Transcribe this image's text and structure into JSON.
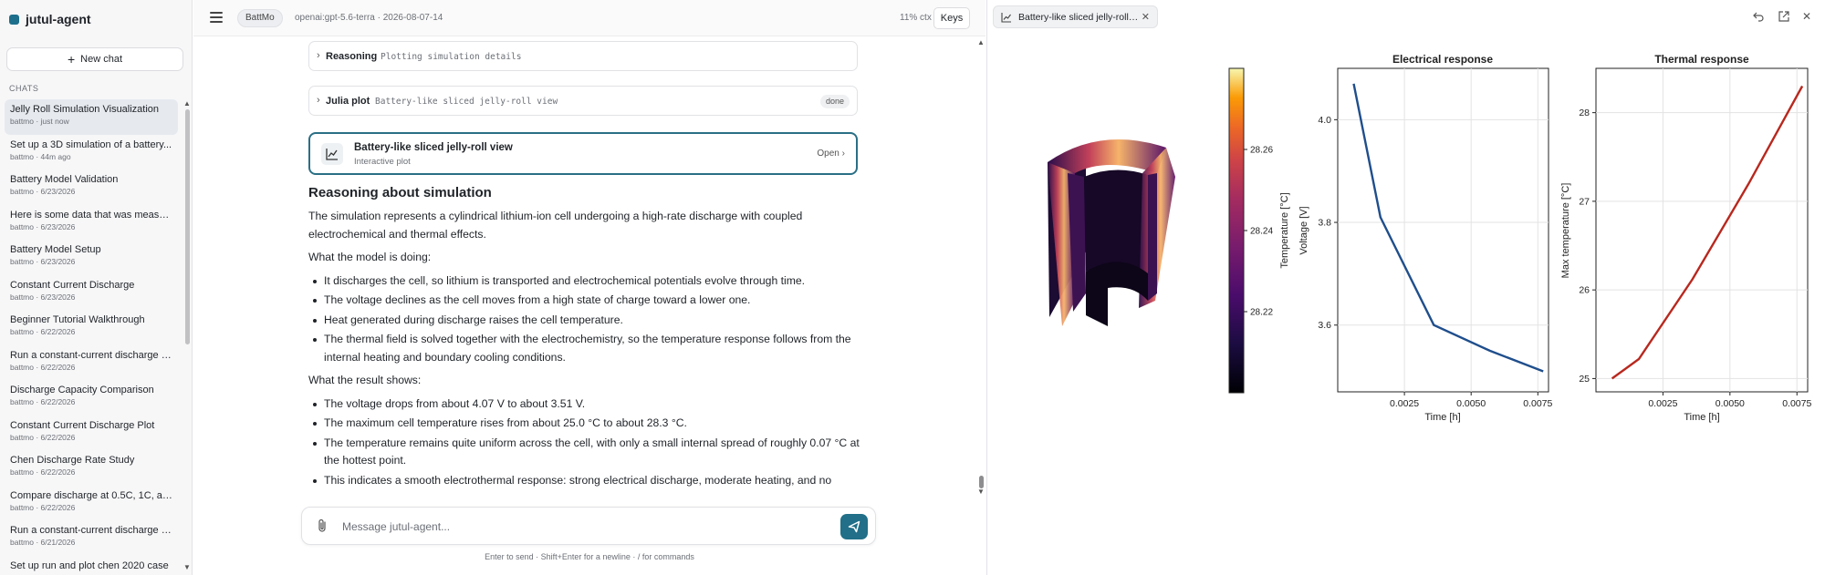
{
  "app": {
    "name": "jutul-agent"
  },
  "sidebar": {
    "new_chat_label": "New chat",
    "chats_heading": "CHATS",
    "chats": [
      {
        "title": "Jelly Roll Simulation Visualization",
        "subtitle": "battmo · just now",
        "active": true
      },
      {
        "title": "Set up a 3D simulation of a battery...",
        "subtitle": "battmo · 44m ago"
      },
      {
        "title": "Battery Model Validation",
        "subtitle": "battmo · 6/23/2026"
      },
      {
        "title": "Here is some data that was measur...",
        "subtitle": "battmo · 6/23/2026"
      },
      {
        "title": "Battery Model Setup",
        "subtitle": "battmo · 6/23/2026"
      },
      {
        "title": "Constant Current Discharge",
        "subtitle": "battmo · 6/23/2026"
      },
      {
        "title": "Beginner Tutorial Walkthrough",
        "subtitle": "battmo · 6/22/2026"
      },
      {
        "title": "Run a constant-current discharge o...",
        "subtitle": "battmo · 6/22/2026"
      },
      {
        "title": "Discharge Capacity Comparison",
        "subtitle": "battmo · 6/22/2026"
      },
      {
        "title": "Constant Current Discharge Plot",
        "subtitle": "battmo · 6/22/2026"
      },
      {
        "title": "Chen Discharge Rate Study",
        "subtitle": "battmo · 6/22/2026"
      },
      {
        "title": "Compare discharge at 0.5C, 1C, an...",
        "subtitle": "battmo · 6/22/2026"
      },
      {
        "title": "Run a constant-current discharge o...",
        "subtitle": "battmo · 6/21/2026"
      },
      {
        "title": "Set up run and plot chen 2020 case",
        "subtitle": ""
      }
    ]
  },
  "topbar": {
    "project": "BattMo",
    "model_meta": "openai:gpt-5.6-terra · 2026-08-07-14",
    "context": "11% ctx",
    "keys_label": "Keys"
  },
  "messages": {
    "reasoning": {
      "label": "Reasoning",
      "detail": "Plotting simulation details"
    },
    "julia_plot": {
      "label": "Julia plot",
      "detail": "Battery-like sliced jelly-roll view",
      "status": "done"
    },
    "plot_card": {
      "title": "Battery-like sliced jelly-roll view",
      "subtitle": "Interactive plot",
      "action": "Open"
    },
    "answer": {
      "heading": "Reasoning about simulation",
      "intro": "The simulation represents a cylindrical lithium-ion cell undergoing a high-rate discharge with coupled electrochemical and thermal effects.",
      "model_heading": "What the model is doing:",
      "model_points": [
        "It discharges the cell, so lithium is transported and electrochemical potentials evolve through time.",
        "The voltage declines as the cell moves from a high state of charge toward a lower one.",
        "Heat generated during discharge raises the cell temperature.",
        "The thermal field is solved together with the electrochemistry, so the temperature response follows from the internal heating and boundary cooling conditions."
      ],
      "result_heading": "What the result shows:",
      "result_points": [
        "The voltage drops from about 4.07 V to about 3.51 V.",
        "The maximum cell temperature rises from about 25.0 °C to about 28.3 °C.",
        "The temperature remains quite uniform across the cell, with only a small internal spread of roughly 0.07 °C at the hottest point.",
        "This indicates a smooth electrothermal response: strong electrical discharge, moderate heating, and no"
      ]
    }
  },
  "composer": {
    "placeholder": "Message jutul-agent...",
    "hint": "Enter to send · Shift+Enter for a newline · / for commands"
  },
  "panel": {
    "tab_title": "Battery-like sliced jelly-roll ..."
  },
  "colors": {
    "accent": "#216f88",
    "voltage_line": "#1f4e8c",
    "temperature_line": "#b8281e"
  },
  "icons": [
    "menu-icon",
    "plus-icon",
    "chevron-right-icon",
    "chart-icon",
    "paperclip-icon",
    "send-icon",
    "back-icon",
    "popout-icon",
    "close-icon"
  ],
  "chart_data": [
    {
      "type": "heatmap",
      "title": "",
      "colorbar_label": "Temperature [°C]",
      "colorbar_ticks": [
        28.22,
        28.24,
        28.26
      ],
      "colorbar_range": [
        28.2,
        28.28
      ],
      "colormap": "inferno"
    },
    {
      "type": "line",
      "title": "Electrical response",
      "xlabel": "Time [h]",
      "ylabel": "Voltage [V]",
      "xticks": [
        0.0025,
        0.005,
        0.0075
      ],
      "xtick_labels": [
        "0.0025",
        "0.0050",
        "0.0075"
      ],
      "yticks": [
        3.6,
        3.8,
        4.0
      ],
      "ytick_labels": [
        "3.6",
        "3.8",
        "4.0"
      ],
      "xlim": [
        0.0,
        0.0079
      ],
      "ylim": [
        3.47,
        4.1
      ],
      "grid": true,
      "series": [
        {
          "x": [
            0.0006,
            0.0016,
            0.0036,
            0.0057,
            0.0077
          ],
          "y": [
            4.07,
            3.81,
            3.6,
            3.55,
            3.51
          ]
        }
      ]
    },
    {
      "type": "line",
      "title": "Thermal response",
      "xlabel": "Time [h]",
      "ylabel": "Max temperature [°C]",
      "xticks": [
        0.0025,
        0.005,
        0.0075
      ],
      "xtick_labels": [
        "0.0025",
        "0.0050",
        "0.0075"
      ],
      "yticks": [
        25,
        26,
        27,
        28
      ],
      "ytick_labels": [
        "25",
        "26",
        "27",
        "28"
      ],
      "xlim": [
        0.0,
        0.0079
      ],
      "ylim": [
        24.85,
        28.5
      ],
      "grid": true,
      "series": [
        {
          "x": [
            0.0006,
            0.0016,
            0.0036,
            0.0057,
            0.0077
          ],
          "y": [
            25.0,
            25.22,
            26.12,
            27.2,
            28.3
          ]
        }
      ]
    }
  ]
}
